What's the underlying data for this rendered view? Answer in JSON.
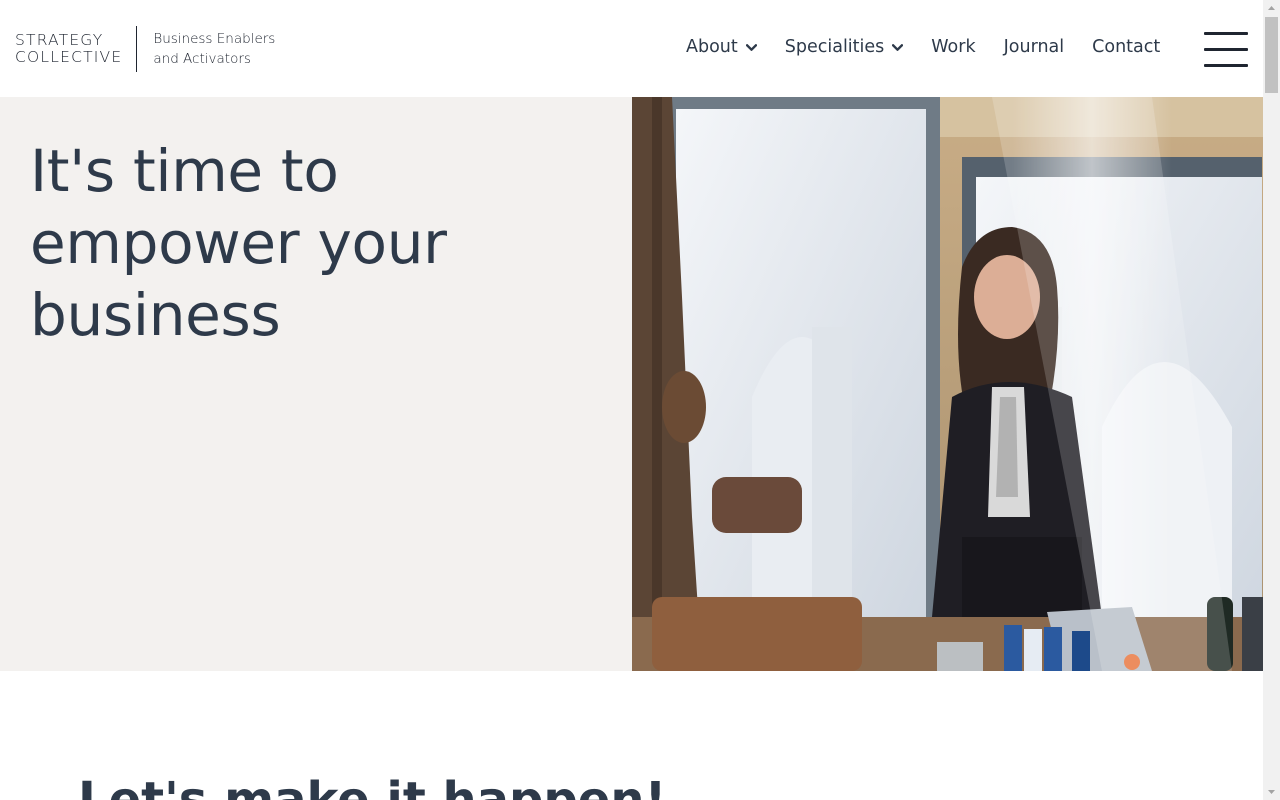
{
  "logo": {
    "line1": "STRATEGY",
    "line2": "COLLECTIVE",
    "tagline1": "Business Enablers",
    "tagline2": "and Activators"
  },
  "nav": {
    "items": [
      {
        "label": "About",
        "has_dropdown": true
      },
      {
        "label": "Specialities",
        "has_dropdown": true
      },
      {
        "label": "Work",
        "has_dropdown": false
      },
      {
        "label": "Journal",
        "has_dropdown": false
      },
      {
        "label": "Contact",
        "has_dropdown": false
      }
    ],
    "menu_icon": "hamburger-icon"
  },
  "hero": {
    "title": "It's time to empower your business",
    "image": "meeting-photo"
  },
  "section": {
    "heading": "Let's make it happen!"
  },
  "colors": {
    "text": "#2e3a4a",
    "hero_bg": "#f3f1ef",
    "header_bg": "#ffffff"
  }
}
